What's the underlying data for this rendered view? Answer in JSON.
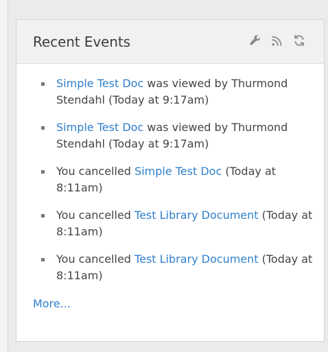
{
  "widget": {
    "title": "Recent Events",
    "tools": [
      {
        "icon": "wrench-icon",
        "name": "settings"
      },
      {
        "icon": "rss-icon",
        "name": "feed"
      },
      {
        "icon": "refresh-icon",
        "name": "refresh"
      }
    ],
    "events": [
      {
        "link_text": "Simple Test Doc",
        "text_after": " was viewed by Thurmond Stendahl (Today at 9:17am)"
      },
      {
        "link_text": "Simple Test Doc",
        "text_after": " was viewed by Thurmond Stendahl (Today at 9:17am)"
      },
      {
        "text_before": "You cancelled ",
        "link_text": "Simple Test Doc",
        "text_after": " (Today at 8:11am)"
      },
      {
        "text_before": "You cancelled ",
        "link_text": "Test Library Document",
        "text_after": " (Today at 8:11am)"
      },
      {
        "text_before": "You cancelled ",
        "link_text": "Test Library Document",
        "text_after": " (Today at 8:11am)"
      }
    ],
    "more_label": "More..."
  },
  "colors": {
    "link": "#2f7fcc",
    "title": "#3d3d3d",
    "text": "#444444",
    "header_bg": "#f1f1f1"
  }
}
